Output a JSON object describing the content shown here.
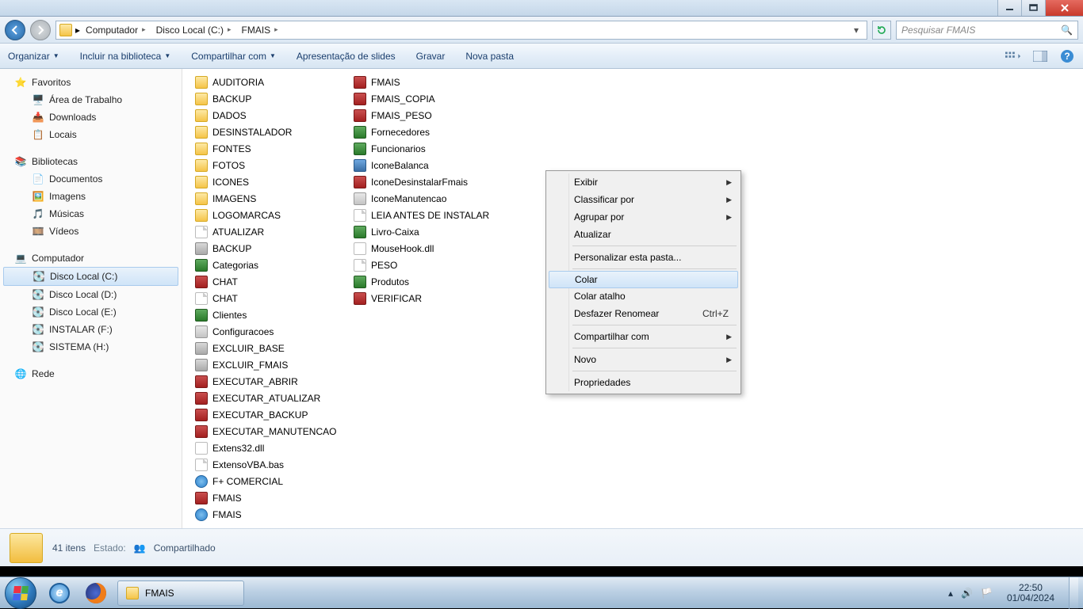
{
  "breadcrumb": {
    "root_icon": "computer",
    "parts": [
      "Computador",
      "Disco Local (C:)",
      "FMAIS"
    ]
  },
  "search": {
    "placeholder": "Pesquisar FMAIS"
  },
  "toolbar": {
    "organize": "Organizar",
    "include": "Incluir na biblioteca",
    "share": "Compartilhar com",
    "slideshow": "Apresentação de slides",
    "burn": "Gravar",
    "newfolder": "Nova pasta"
  },
  "nav": {
    "favorites": "Favoritos",
    "fav_items": [
      "Área de Trabalho",
      "Downloads",
      "Locais"
    ],
    "libraries": "Bibliotecas",
    "lib_items": [
      "Documentos",
      "Imagens",
      "Músicas",
      "Vídeos"
    ],
    "computer": "Computador",
    "drives": [
      "Disco Local (C:)",
      "Disco Local (D:)",
      "Disco Local (E:)",
      "INSTALAR (F:)",
      "SISTEMA (H:)"
    ],
    "network": "Rede"
  },
  "files_col1": [
    {
      "n": "AUDITORIA",
      "t": "folder"
    },
    {
      "n": "BACKUP",
      "t": "folder"
    },
    {
      "n": "DADOS",
      "t": "folder"
    },
    {
      "n": "DESINSTALADOR",
      "t": "folder"
    },
    {
      "n": "FONTES",
      "t": "folder"
    },
    {
      "n": "FOTOS",
      "t": "folder"
    },
    {
      "n": "ICONES",
      "t": "folder"
    },
    {
      "n": "IMAGENS",
      "t": "folder"
    },
    {
      "n": "LOGOMARCAS",
      "t": "folder"
    },
    {
      "n": "ATUALIZAR",
      "t": "file"
    },
    {
      "n": "BACKUP",
      "t": "bat"
    },
    {
      "n": "Categorias",
      "t": "excel"
    },
    {
      "n": "CHAT",
      "t": "access"
    },
    {
      "n": "CHAT",
      "t": "file"
    },
    {
      "n": "Clientes",
      "t": "excel"
    },
    {
      "n": "Configuracoes",
      "t": "exe"
    },
    {
      "n": "EXCLUIR_BASE",
      "t": "bat"
    },
    {
      "n": "EXCLUIR_FMAIS",
      "t": "bat"
    },
    {
      "n": "EXECUTAR_ABRIR",
      "t": "access"
    },
    {
      "n": "EXECUTAR_ATUALIZAR",
      "t": "access"
    },
    {
      "n": "EXECUTAR_BACKUP",
      "t": "access"
    },
    {
      "n": "EXECUTAR_MANUTENCAO",
      "t": "access"
    },
    {
      "n": "Extens32.dll",
      "t": "dll"
    },
    {
      "n": "ExtensoVBA.bas",
      "t": "file"
    },
    {
      "n": "F+ COMERCIAL",
      "t": "globe"
    },
    {
      "n": "FMAIS",
      "t": "access"
    },
    {
      "n": "FMAIS",
      "t": "globe"
    }
  ],
  "files_col2": [
    {
      "n": "FMAIS",
      "t": "access"
    },
    {
      "n": "FMAIS_COPIA",
      "t": "access"
    },
    {
      "n": "FMAIS_PESO",
      "t": "access"
    },
    {
      "n": "Fornecedores",
      "t": "excel"
    },
    {
      "n": "Funcionarios",
      "t": "excel"
    },
    {
      "n": "IconeBalanca",
      "t": "vid"
    },
    {
      "n": "IconeDesinstalarFmais",
      "t": "access"
    },
    {
      "n": "IconeManutencao",
      "t": "exe"
    },
    {
      "n": "LEIA ANTES DE INSTALAR",
      "t": "file"
    },
    {
      "n": "Livro-Caixa",
      "t": "excel"
    },
    {
      "n": "MouseHook.dll",
      "t": "dll"
    },
    {
      "n": "PESO",
      "t": "file"
    },
    {
      "n": "Produtos",
      "t": "excel"
    },
    {
      "n": "VERIFICAR",
      "t": "access"
    }
  ],
  "context_menu": {
    "exibir": "Exibir",
    "classificar": "Classificar por",
    "agrupar": "Agrupar por",
    "atualizar": "Atualizar",
    "personalizar": "Personalizar esta pasta...",
    "colar": "Colar",
    "colar_atalho": "Colar atalho",
    "desfazer": "Desfazer Renomear",
    "desfazer_sc": "Ctrl+Z",
    "compartilhar": "Compartilhar com",
    "novo": "Novo",
    "propriedades": "Propriedades"
  },
  "details": {
    "count": "41 itens",
    "estado_label": "Estado:",
    "estado_value": "Compartilhado"
  },
  "taskbar": {
    "app": "FMAIS",
    "time": "22:50",
    "date": "01/04/2024"
  }
}
